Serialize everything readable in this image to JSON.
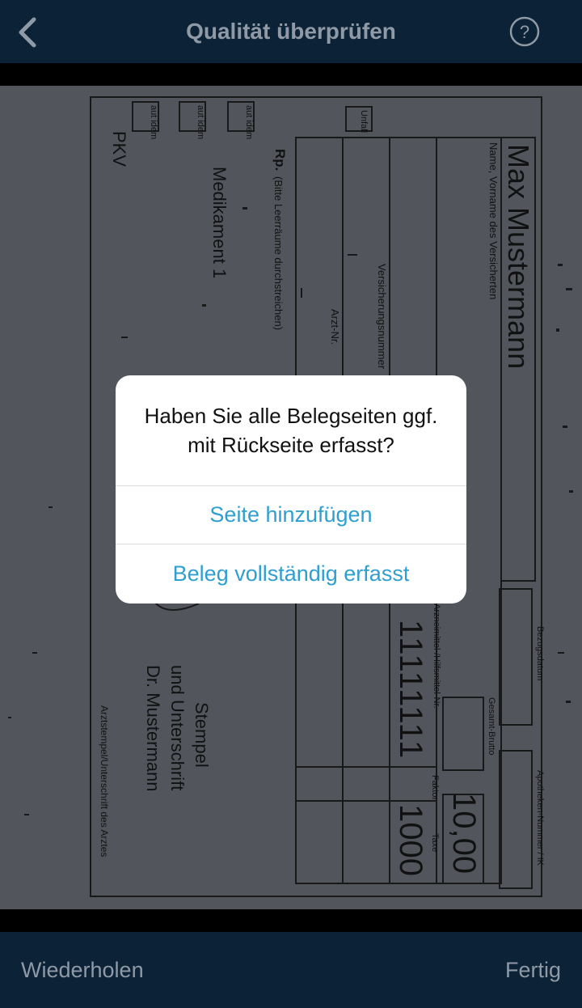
{
  "nav": {
    "title": "Qualität überprüfen"
  },
  "document": {
    "patient_name": "Max Mustermann",
    "name_label": "Name, Vorname des Versicherten",
    "insurer": "PKV",
    "rp_label": "Rp.",
    "rp_hint": "(Bitte Leerräume durchstreichen)",
    "medication": "Medikament 1",
    "arzt_nr": "Arzt-Nr.",
    "versicherungsnummer": "Versicherungsnummer",
    "unfall": "Unfall",
    "aut_idem": "aut idem",
    "pzn": "11111111",
    "pzn_label": "Arzneimittel-/Hilfsmittel-Nr.",
    "faktor_label": "Faktor",
    "taxe_label": "Taxe",
    "taxe_value": "1000",
    "gesamt_brutto_label": "Gesamt-Brutto",
    "gesamt_brutto_value": "10,00",
    "bezugsdatum_label": "Bezugsdatum",
    "apotheken_label": "Apotheken-Nummer / IK",
    "stempel_line1": "Stempel",
    "stempel_line2": "und Unterschrift",
    "stempel_line3": "Dr. Mustermann",
    "signature_label": "Arztstempel/Unterschrift des Arztes"
  },
  "dialog": {
    "message": "Haben Sie alle Belegseiten ggf. mit Rückseite erfasst?",
    "add_page_label": "Seite hinzufügen",
    "complete_label": "Beleg vollständig erfasst"
  },
  "toolbar": {
    "retry_label": "Wiederholen",
    "done_label": "Fertig"
  },
  "colors": {
    "bar_background": "#0c2236",
    "bar_text": "#8f9aa6",
    "dialog_button": "#2f9fd0",
    "document_background": "#60656b"
  }
}
